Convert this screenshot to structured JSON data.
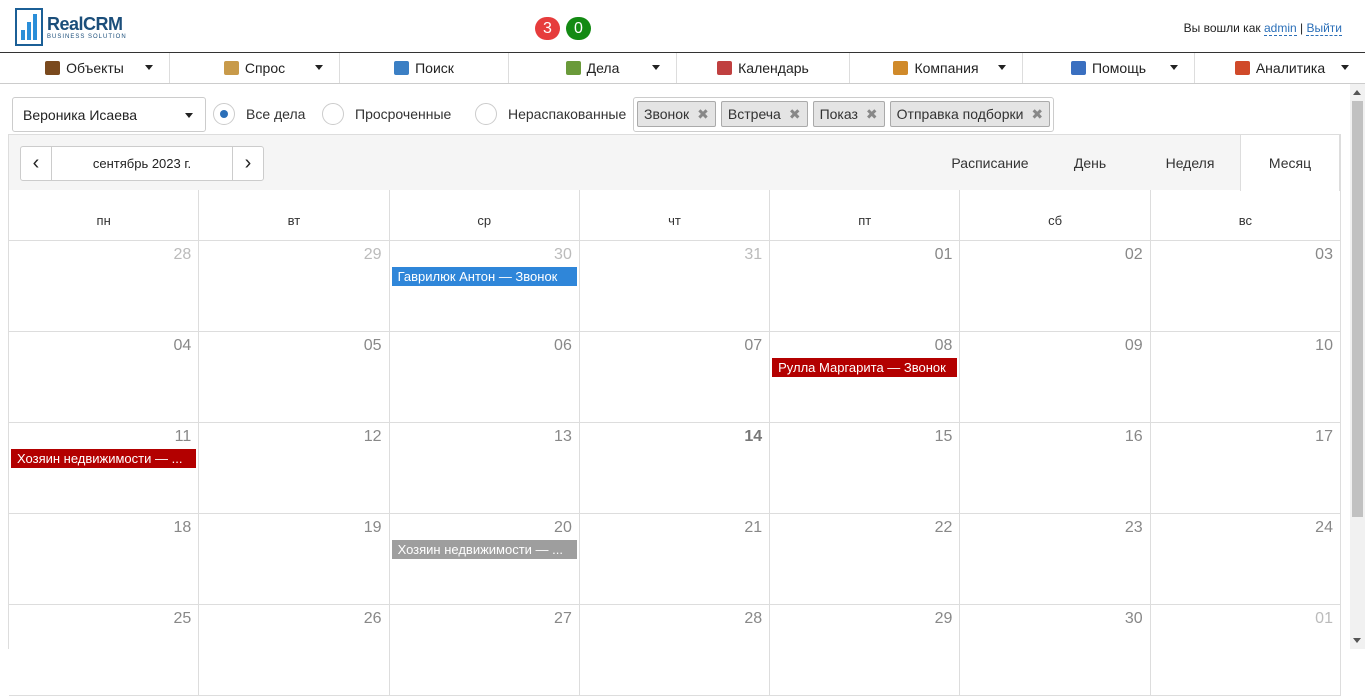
{
  "header": {
    "logo_name": "RealCRM",
    "logo_sub": "BUSINESS SOLUTION",
    "badge_red": "3",
    "badge_green": "0",
    "user_prefix": "Вы вошли как",
    "user_name": "admin",
    "separator": "|",
    "logout": "Выйти"
  },
  "nav": [
    {
      "label": "Объекты",
      "icon": "briefcase-icon",
      "color": "#7a4a1e",
      "dropdown": true
    },
    {
      "label": "Спрос",
      "icon": "demand-icon",
      "color": "#c89a4a",
      "dropdown": true
    },
    {
      "label": "Поиск",
      "icon": "magnifier-icon",
      "color": "#3b7fc4",
      "dropdown": false
    },
    {
      "label": "Дела",
      "icon": "tasks-icon",
      "color": "#6a9a3a",
      "dropdown": true
    },
    {
      "label": "Календарь",
      "icon": "calendar-icon",
      "color": "#c04040",
      "dropdown": false
    },
    {
      "label": "Компания",
      "icon": "people-icon",
      "color": "#d08a2a",
      "dropdown": true
    },
    {
      "label": "Помощь",
      "icon": "help-icon",
      "color": "#3a6fc0",
      "dropdown": true
    },
    {
      "label": "Аналитика",
      "icon": "chart-icon",
      "color": "#d04a2a",
      "dropdown": true
    }
  ],
  "filters": {
    "user_select": "Вероника Исаева",
    "radios": [
      {
        "label": "Все дела",
        "checked": true
      },
      {
        "label": "Просроченные",
        "checked": false
      },
      {
        "label": "Нераспакованные",
        "checked": false
      }
    ],
    "tags": [
      "Звонок",
      "Встреча",
      "Показ",
      "Отправка подборки"
    ],
    "tag_remove": "✖"
  },
  "toolbar": {
    "prev": "‹",
    "next": "›",
    "date_label": "сентябрь 2023 г.",
    "views": [
      {
        "label": "Расписание",
        "active": false
      },
      {
        "label": "День",
        "active": false
      },
      {
        "label": "Неделя",
        "active": false
      },
      {
        "label": "Месяц",
        "active": true
      }
    ]
  },
  "calendar": {
    "weekdays": [
      "пн",
      "вт",
      "ср",
      "чт",
      "пт",
      "сб",
      "вс"
    ],
    "weeks": [
      [
        {
          "n": "28",
          "other": true
        },
        {
          "n": "29",
          "other": true
        },
        {
          "n": "30",
          "other": true,
          "event": {
            "text": "Гаврилюк Антон — Звонок",
            "color": "blue"
          }
        },
        {
          "n": "31",
          "other": true
        },
        {
          "n": "01"
        },
        {
          "n": "02"
        },
        {
          "n": "03"
        }
      ],
      [
        {
          "n": "04"
        },
        {
          "n": "05"
        },
        {
          "n": "06"
        },
        {
          "n": "07"
        },
        {
          "n": "08",
          "event": {
            "text": "Рулла Маргарита — Звонок",
            "color": "red"
          }
        },
        {
          "n": "09"
        },
        {
          "n": "10"
        }
      ],
      [
        {
          "n": "11",
          "event": {
            "text": "Хозяин недвижимости — ...",
            "color": "red"
          }
        },
        {
          "n": "12"
        },
        {
          "n": "13"
        },
        {
          "n": "14",
          "today": true
        },
        {
          "n": "15"
        },
        {
          "n": "16"
        },
        {
          "n": "17"
        }
      ],
      [
        {
          "n": "18"
        },
        {
          "n": "19"
        },
        {
          "n": "20",
          "event": {
            "text": "Хозяин недвижимости — ...",
            "color": "gray"
          }
        },
        {
          "n": "21"
        },
        {
          "n": "22"
        },
        {
          "n": "23"
        },
        {
          "n": "24"
        }
      ],
      [
        {
          "n": "25"
        },
        {
          "n": "26"
        },
        {
          "n": "27"
        },
        {
          "n": "28"
        },
        {
          "n": "29"
        },
        {
          "n": "30"
        },
        {
          "n": "01",
          "other": true
        }
      ]
    ]
  }
}
